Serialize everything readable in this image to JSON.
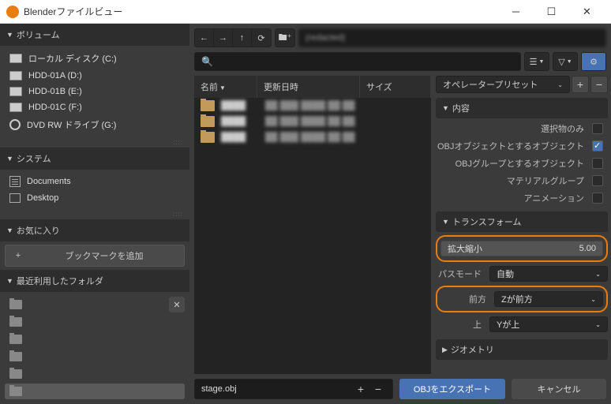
{
  "window": {
    "title": "Blenderファイルビュー"
  },
  "volumes": {
    "header": "ボリューム",
    "items": [
      {
        "label": "ローカル ディスク (C:)",
        "icon": "drive"
      },
      {
        "label": "HDD-01A (D:)",
        "icon": "drive"
      },
      {
        "label": "HDD-01B (E:)",
        "icon": "drive"
      },
      {
        "label": "HDD-01C (F:)",
        "icon": "drive"
      },
      {
        "label": "DVD RW ドライブ (G:)",
        "icon": "disc"
      }
    ]
  },
  "system": {
    "header": "システム",
    "items": [
      {
        "label": "Documents",
        "icon": "doc"
      },
      {
        "label": "Desktop",
        "icon": "desktop"
      }
    ]
  },
  "favorites": {
    "header": "お気に入り",
    "bookmark_btn": "ブックマークを追加"
  },
  "recent": {
    "header": "最近利用したフォルダ",
    "count": 6,
    "selected_index": 5
  },
  "path_display": "(redacted)",
  "file_cols": {
    "name": "名前",
    "modified": "更新日時",
    "size": "サイズ"
  },
  "files": [
    {
      "name": "████",
      "modified": "██ ███ ████ ██:██"
    },
    {
      "name": "████",
      "modified": "██ ███ ████ ██:██"
    },
    {
      "name": "████",
      "modified": "██ ███ ████ ██:██"
    }
  ],
  "options": {
    "preset_label": "オペレータープリセット",
    "sections": {
      "content": "内容",
      "transform": "トランスフォーム",
      "geometry": "ジオメトリ"
    },
    "content_opts": {
      "selection_only": {
        "label": "選択物のみ",
        "checked": false
      },
      "obj_objects": {
        "label": "OBJオブジェクトとするオブジェクト",
        "checked": true
      },
      "obj_groups": {
        "label": "OBJグループとするオブジェクト",
        "checked": false
      },
      "material_groups": {
        "label": "マテリアルグループ",
        "checked": false
      },
      "animation": {
        "label": "アニメーション",
        "checked": false
      }
    },
    "transform_opts": {
      "scale": {
        "label": "拡大縮小",
        "value": "5.00"
      },
      "path_mode": {
        "label": "パスモード",
        "value": "自動"
      },
      "forward": {
        "label": "前方",
        "value": "Zが前方"
      },
      "up": {
        "label": "上",
        "value": "Yが上"
      }
    }
  },
  "filename": "stage.obj",
  "export_btn": "OBJをエクスポート",
  "cancel_btn": "キャンセル"
}
